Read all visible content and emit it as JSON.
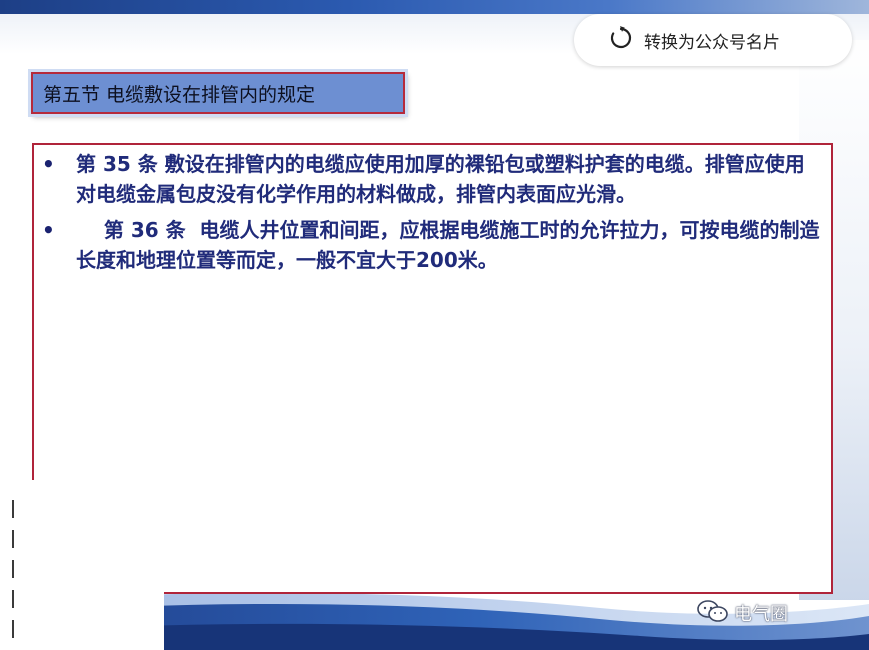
{
  "toolbar": {
    "convert_label": "转换为公众号名片",
    "refresh_icon": "refresh-icon"
  },
  "slide": {
    "section_title": "第五节  电缆敷设在排管内的规定",
    "bullet_symbol": "•",
    "items": [
      "第 35 条  敷设在排管内的电缆应使用加厚的裸铅包或塑料护套的电缆。排管应使用对电缆金属包皮没有化学作用的材料做成，排管内表面应光滑。",
      "    第 36 条  电缆人井位置和间距，应根据电缆施工时的允许拉力，可按电缆的制造长度和地理位置等而定，一般不宜大于200米。"
    ]
  },
  "watermark": {
    "icon": "wechat-icon",
    "text": "电气圈"
  },
  "colors": {
    "title_bg": "#6d8fd2",
    "frame_border": "#b0243a",
    "body_text": "#202b7a",
    "band_dark": "#1d3f86"
  }
}
